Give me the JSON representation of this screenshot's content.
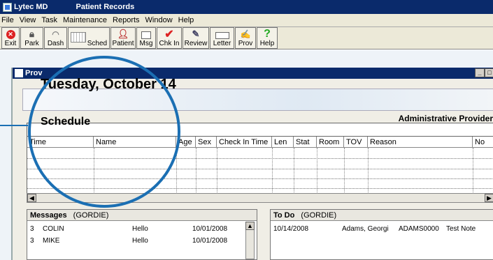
{
  "titlebar": {
    "app": "Lytec MD",
    "window": "Patient Records"
  },
  "menu": [
    "File",
    "View",
    "Task",
    "Maintenance",
    "Reports",
    "Window",
    "Help"
  ],
  "toolbar": [
    {
      "label": "Exit",
      "icon": "exit-icon"
    },
    {
      "label": "Park",
      "icon": "lock-icon"
    },
    {
      "label": "Dash",
      "icon": "dashboard-icon"
    },
    {
      "label": "Sched",
      "icon": "calendar-icon"
    },
    {
      "label": "Patient",
      "icon": "patient-icon"
    },
    {
      "label": "Msg",
      "icon": "message-icon"
    },
    {
      "label": "Chk In",
      "icon": "checkmark-icon"
    },
    {
      "label": "Review",
      "icon": "review-icon"
    },
    {
      "label": "Letter",
      "icon": "letter-icon"
    },
    {
      "label": "Prov",
      "icon": "provider-icon"
    },
    {
      "label": "Help",
      "icon": "help-icon"
    }
  ],
  "child_window": {
    "title": "Prov"
  },
  "header": {
    "date": "Tuesday, October 14",
    "provider": "Administrative Provider"
  },
  "schedule": {
    "title": "Schedule",
    "columns": [
      "Time",
      "Name",
      "Age",
      "Sex",
      "Check In Time",
      "Len",
      "Stat",
      "Room",
      "TOV",
      "Reason",
      "No"
    ]
  },
  "messages": {
    "title": "Messages",
    "owner": "(GORDIE)",
    "rows": [
      {
        "num": "3",
        "name": "COLIN",
        "subject": "Hello",
        "date": "10/01/2008"
      },
      {
        "num": "3",
        "name": "MIKE",
        "subject": "Hello",
        "date": "10/01/2008"
      }
    ]
  },
  "todo": {
    "title": "To Do",
    "owner": "(GORDIE)",
    "rows": [
      {
        "date": "10/14/2008",
        "patient": "Adams, Georgi",
        "account": "ADAMS0000",
        "note": "Test Note"
      }
    ]
  },
  "colors": {
    "titlebar": "#0a2a6b",
    "highlight_circle": "#1b6fb3"
  }
}
